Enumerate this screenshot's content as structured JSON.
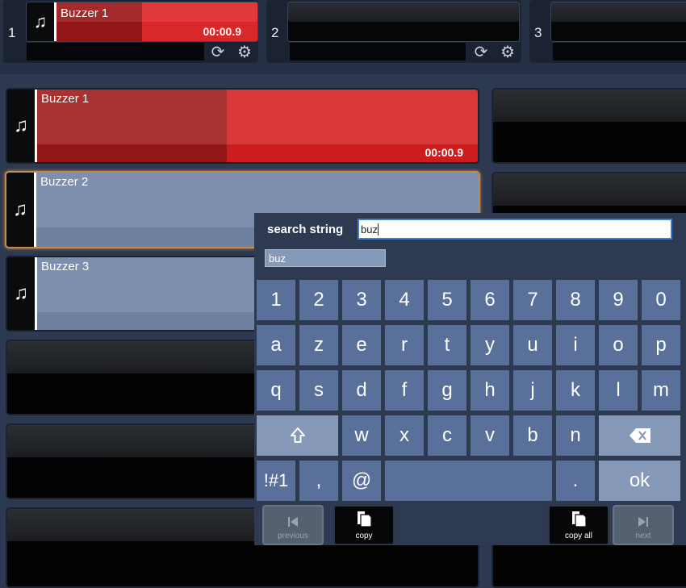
{
  "decks": [
    {
      "number": "1",
      "title": "Buzzer 1",
      "time": "00:00.9"
    },
    {
      "number": "2",
      "title": "",
      "time": ""
    },
    {
      "number": "3",
      "title": "",
      "time": ""
    }
  ],
  "tiles": [
    {
      "title": "Buzzer 1",
      "time": "00:00.9",
      "state": "playing"
    },
    {
      "title": "Buzzer 2",
      "time": "",
      "state": "selected"
    },
    {
      "title": "Buzzer 3",
      "time": "",
      "state": "idle"
    }
  ],
  "search": {
    "label": "search string",
    "value": "buz",
    "suggestion": "buz"
  },
  "keyboard": {
    "row1": [
      "1",
      "2",
      "3",
      "4",
      "5",
      "6",
      "7",
      "8",
      "9",
      "0"
    ],
    "row2": [
      "a",
      "z",
      "e",
      "r",
      "t",
      "y",
      "u",
      "i",
      "o",
      "p"
    ],
    "row3": [
      "q",
      "s",
      "d",
      "f",
      "g",
      "h",
      "j",
      "k",
      "l",
      "m"
    ],
    "row4": [
      "w",
      "x",
      "c",
      "v",
      "b",
      "n"
    ],
    "symbols": "!#1",
    "comma": ",",
    "at": "@",
    "dot": ".",
    "ok": "ok"
  },
  "buttons": {
    "previous": "previous",
    "copy": "copy",
    "copy_all": "copy all",
    "next": "next"
  },
  "colors": {
    "playing": "#d9282a",
    "tile_selected": "#7d8fad",
    "key": "#58709a",
    "key_light": "#8799b8"
  },
  "icons": [
    "music-note-icon",
    "loop-icon",
    "gear-icon",
    "shift-icon",
    "backspace-icon",
    "skip-previous-icon",
    "copy-icon",
    "skip-next-icon"
  ]
}
